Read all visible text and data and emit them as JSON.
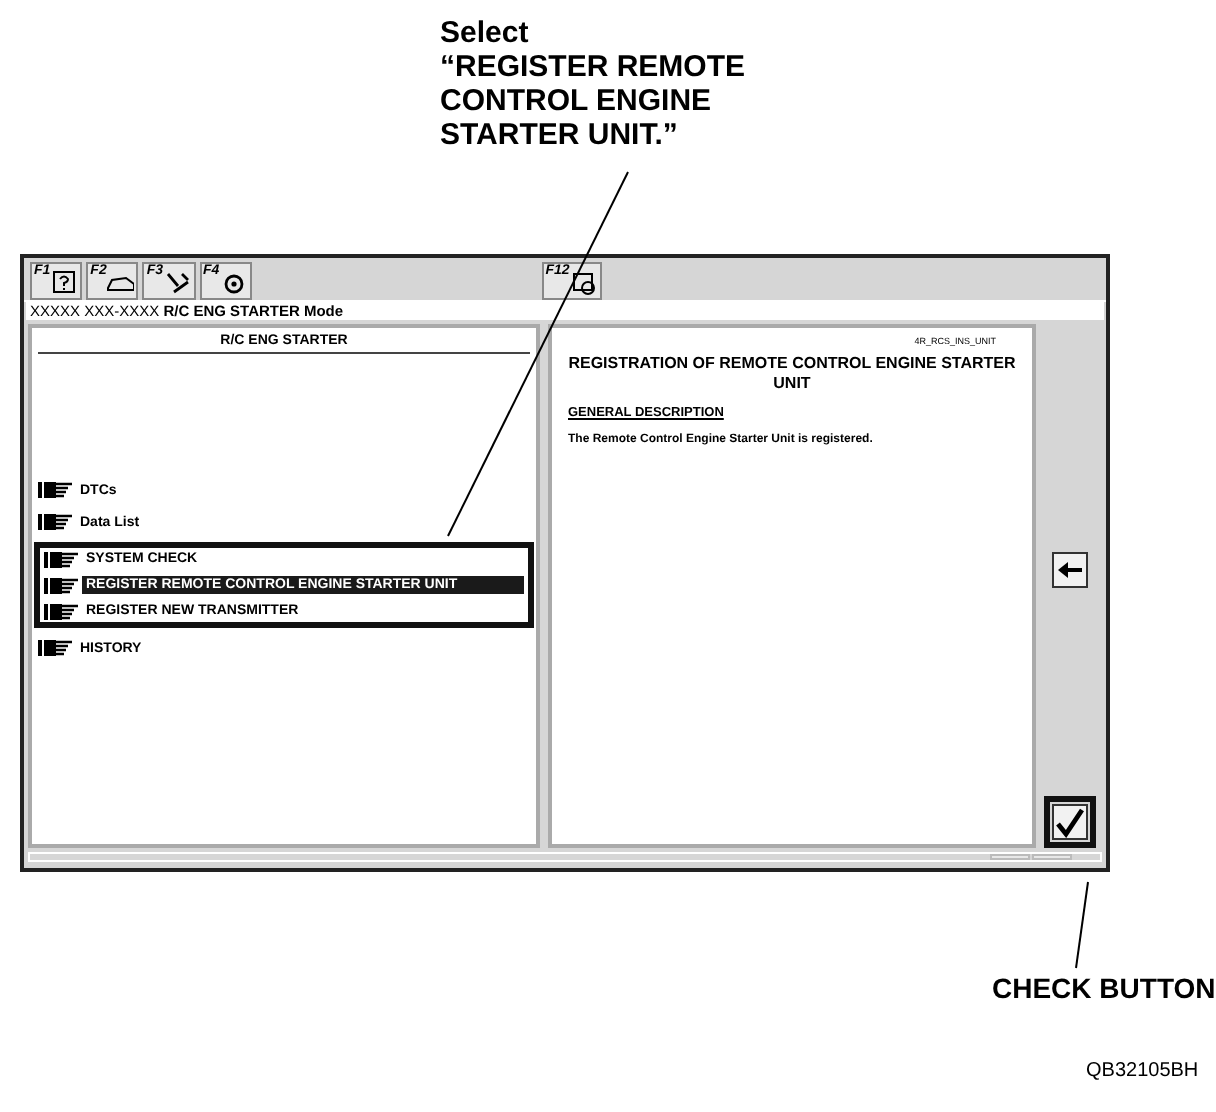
{
  "callout": {
    "lines": [
      "Select",
      "“REGISTER REMOTE",
      "CONTROL ENGINE",
      "STARTER UNIT.”"
    ]
  },
  "toolbar": {
    "keys": [
      {
        "label": "F1",
        "kind": "help"
      },
      {
        "label": "F2",
        "kind": "car"
      },
      {
        "label": "F3",
        "kind": "tool"
      },
      {
        "label": "F4",
        "kind": "gear"
      }
    ],
    "right_key": {
      "label": "F12",
      "kind": "print"
    }
  },
  "window": {
    "title": "XXXXX XXX-XXXX **R/C ENG STARTER Mode**"
  },
  "menu": {
    "header": "R/C ENG STARTER",
    "items": [
      {
        "label": "DTCs",
        "selected": false,
        "framed": false
      },
      {
        "label": "Data List",
        "selected": false,
        "framed": false
      },
      {
        "label": "SYSTEM CHECK",
        "selected": false,
        "framed": true
      },
      {
        "label": "REGISTER REMOTE CONTROL ENGINE STARTER UNIT",
        "selected": true,
        "framed": true
      },
      {
        "label": "REGISTER NEW TRANSMITTER",
        "selected": false,
        "framed": true
      },
      {
        "label": "HISTORY",
        "selected": false,
        "framed": false
      }
    ]
  },
  "document": {
    "code": "4R_RCS_INS_UNIT",
    "heading": "REGISTRATION OF REMOTE CONTROL ENGINE STARTER UNIT",
    "section": "GENERAL DESCRIPTION",
    "body": "The Remote Control Engine Starter Unit is registered."
  },
  "side_buttons": [
    {
      "kind": "back",
      "framed": false
    },
    {
      "kind": "check",
      "framed": true
    }
  ],
  "check_label": "CHECK BUTTON",
  "figure_id": "QB32105BH"
}
